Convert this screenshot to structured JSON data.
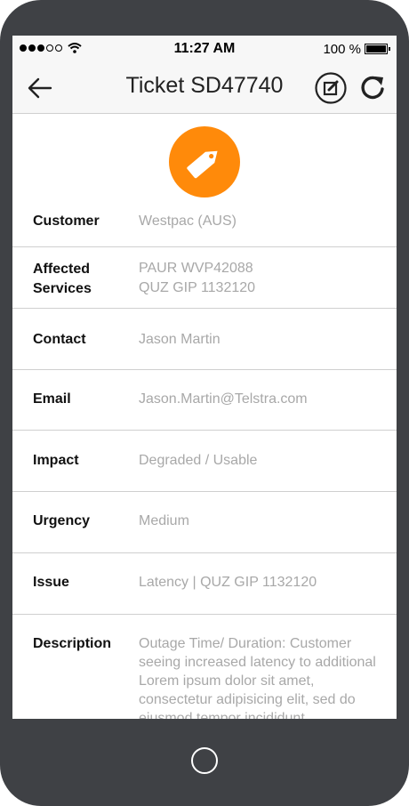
{
  "status_bar": {
    "time": "11:27 AM",
    "battery_text": "100 %"
  },
  "nav": {
    "title": "Ticket SD47740",
    "back_icon": "back-arrow-icon",
    "edit_icon": "edit-icon",
    "refresh_icon": "refresh-icon"
  },
  "header_icon": "tag-icon",
  "accent_color": "#ff8a0a",
  "fields": {
    "customer": {
      "label": "Customer",
      "value": "Westpac (AUS)"
    },
    "affected_services": {
      "label_line1": "Affected",
      "label_line2": "Services",
      "value_line1": "PAUR WVP42088",
      "value_line2": "QUZ GIP 1132120"
    },
    "contact": {
      "label": "Contact",
      "value": "Jason Martin"
    },
    "email": {
      "label": "Email",
      "value": "Jason.Martin@Telstra.com"
    },
    "impact": {
      "label": "Impact",
      "value": "Degraded / Usable"
    },
    "urgency": {
      "label": "Urgency",
      "value": "Medium"
    },
    "issue": {
      "label": "Issue",
      "value": "Latency | QUZ GIP 1132120"
    },
    "description": {
      "label": "Description",
      "value": "Outage Time/ Duration: Customer seeing increased latency to additional Lorem ipsum dolor sit amet, consectetur adipisicing elit, sed do eiusmod tempor incididunt"
    }
  }
}
